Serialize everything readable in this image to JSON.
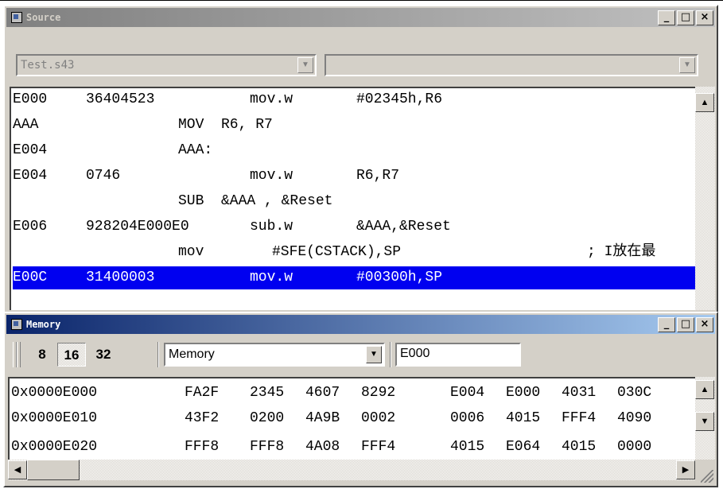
{
  "source_window": {
    "title": "Source",
    "window_buttons": [
      "_",
      "□",
      "×"
    ],
    "file_combo": "Test.s43",
    "function_combo": "",
    "lines": [
      {
        "addr": "E000",
        "code": "36404523",
        "mnemonic": "mov.w",
        "operands": "#02345h,R6",
        "selected": false
      },
      {
        "addr": "AAA",
        "code": "",
        "mnemonic": "MOV",
        "operands": "R6, R7",
        "selected": false
      },
      {
        "addr": "E004",
        "code": "",
        "mnemonic": "AAA:",
        "operands": "",
        "selected": false
      },
      {
        "addr": "E004",
        "code": "0746",
        "mnemonic": "mov.w",
        "operands": "R6,R7",
        "selected": false
      },
      {
        "addr": "",
        "code": "",
        "mnemonic": "SUB",
        "operands": "&AAA , &Reset",
        "selected": false
      },
      {
        "addr": "E006",
        "code": "928204E000E0",
        "mnemonic": "sub.w",
        "operands": "&AAA,&Reset",
        "selected": false
      },
      {
        "addr": "",
        "code": "",
        "mnemonic": "mov",
        "operands": "#SFE(CSTACK),SP",
        "comment": "; I放在最",
        "selected": false
      },
      {
        "addr": "E00C",
        "code": "31400003",
        "mnemonic": "mov.w",
        "operands": "#00300h,SP",
        "selected": true
      }
    ]
  },
  "memory_window": {
    "title": "Memory",
    "window_buttons": [
      "_",
      "□",
      "×"
    ],
    "width_options": [
      "8",
      "16",
      "32"
    ],
    "selected_width": "16",
    "zone": "Memory",
    "address": "E000",
    "rows": [
      {
        "addr": "0x0000E000",
        "words": [
          "FA2F",
          "2345",
          "4607",
          "8292",
          "E004",
          "E000",
          "4031",
          "030C"
        ]
      },
      {
        "addr": "0x0000E010",
        "words": [
          "43F2",
          "0200",
          "4A9B",
          "0002",
          "0006",
          "4015",
          "FFF4",
          "4090"
        ]
      },
      {
        "addr": "0x0000E020",
        "words": [
          "FFF8",
          "FFF8",
          "4A08",
          "FFF4",
          "4015",
          "E064",
          "4015",
          "0000"
        ]
      }
    ]
  },
  "colors": {
    "selection": "#0000f0",
    "active_title": "#0a246a",
    "inactive_title": "#808080",
    "face": "#d4d0c8"
  }
}
